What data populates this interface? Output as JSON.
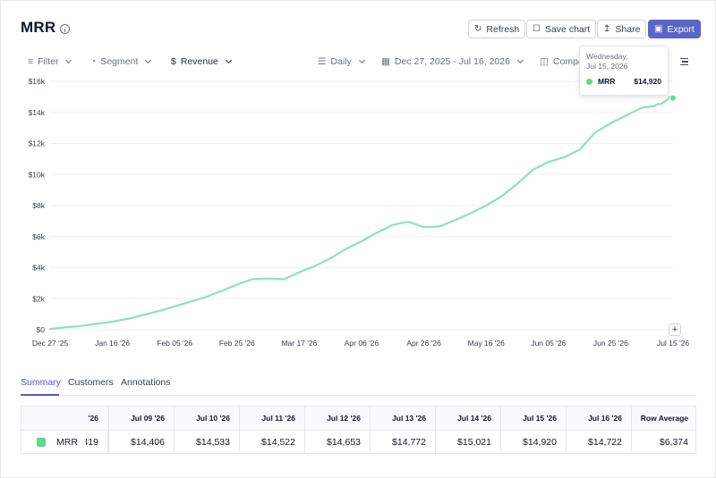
{
  "header": {
    "title": "MRR",
    "buttons": {
      "refresh": "Refresh",
      "save_chart": "Save chart",
      "share": "Share",
      "export": "Export"
    }
  },
  "toolbar": {
    "filter": "Filter",
    "segment": "Segment",
    "revenue": "Revenue",
    "granularity": "Daily",
    "date_range": "Dec 27, 2025 - Jul 16, 2026",
    "compare": "Compa"
  },
  "tooltip": {
    "date_line1": "Wednesday,",
    "date_line2": "Jul 15, 2026",
    "series": "MRR",
    "value": "$14,920"
  },
  "colors": {
    "line": "#8ee3b4",
    "accent": "#5b64c9",
    "series_swatch": "#5ed88a"
  },
  "chart_data": {
    "type": "line",
    "ylim": [
      0,
      16000
    ],
    "y_ticks": [
      "$0",
      "$2k",
      "$4k",
      "$6k",
      "$8k",
      "$10k",
      "$12k",
      "$14k",
      "$16k"
    ],
    "x_ticks": [
      "Dec 27 '25",
      "Jan 16 '26",
      "Feb 05 '26",
      "Feb 25 '26",
      "Mar 17 '26",
      "Apr 06 '26",
      "Apr 26 '26",
      "May 16 '26",
      "Jun 05 '26",
      "Jun 25 '26",
      "Jul 15 '26"
    ],
    "x_start": "2025-12-27",
    "series": [
      {
        "name": "MRR",
        "points": [
          [
            "2025-12-27",
            50
          ],
          [
            "2026-01-01",
            150
          ],
          [
            "2026-01-06",
            250
          ],
          [
            "2026-01-11",
            380
          ],
          [
            "2026-01-16",
            520
          ],
          [
            "2026-01-21",
            700
          ],
          [
            "2026-01-26",
            950
          ],
          [
            "2026-01-31",
            1200
          ],
          [
            "2026-02-05",
            1500
          ],
          [
            "2026-02-10",
            1800
          ],
          [
            "2026-02-15",
            2100
          ],
          [
            "2026-02-20",
            2500
          ],
          [
            "2026-02-25",
            2900
          ],
          [
            "2026-03-02",
            3250
          ],
          [
            "2026-03-07",
            3300
          ],
          [
            "2026-03-12",
            3250
          ],
          [
            "2026-03-17",
            3700
          ],
          [
            "2026-03-22",
            4100
          ],
          [
            "2026-03-27",
            4600
          ],
          [
            "2026-04-01",
            5200
          ],
          [
            "2026-04-06",
            5700
          ],
          [
            "2026-04-11",
            6250
          ],
          [
            "2026-04-16",
            6750
          ],
          [
            "2026-04-21",
            6950
          ],
          [
            "2026-04-26",
            6600
          ],
          [
            "2026-05-01",
            6650
          ],
          [
            "2026-05-06",
            7050
          ],
          [
            "2026-05-11",
            7500
          ],
          [
            "2026-05-16",
            8000
          ],
          [
            "2026-05-21",
            8600
          ],
          [
            "2026-05-26",
            9400
          ],
          [
            "2026-05-31",
            10300
          ],
          [
            "2026-06-05",
            10800
          ],
          [
            "2026-06-10",
            11100
          ],
          [
            "2026-06-15",
            11600
          ],
          [
            "2026-06-20",
            12700
          ],
          [
            "2026-06-25",
            13300
          ],
          [
            "2026-06-30",
            13800
          ],
          [
            "2026-07-05",
            14300
          ],
          [
            "2026-07-09",
            14406
          ],
          [
            "2026-07-10",
            14533
          ],
          [
            "2026-07-11",
            14522
          ],
          [
            "2026-07-12",
            14653
          ],
          [
            "2026-07-13",
            14772
          ],
          [
            "2026-07-14",
            15021
          ],
          [
            "2026-07-15",
            14920
          ]
        ]
      }
    ]
  },
  "tabs": [
    "Summary",
    "Customers",
    "Annotations"
  ],
  "table": {
    "clipped_header": "'26",
    "columns": [
      "Jul 09 '26",
      "Jul 10 '26",
      "Jul 11 '26",
      "Jul 12 '26",
      "Jul 13 '26",
      "Jul 14 '26",
      "Jul 15 '26",
      "Jul 16 '26",
      "Row Average"
    ],
    "row": {
      "label": "MRR",
      "clipped_value": "419",
      "values": [
        "$14,406",
        "$14,533",
        "$14,522",
        "$14,653",
        "$14,772",
        "$15,021",
        "$14,920",
        "$14,722",
        "$6,374"
      ]
    }
  }
}
